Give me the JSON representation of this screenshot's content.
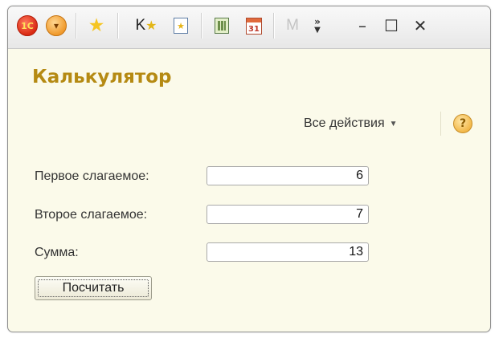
{
  "toolbar": {
    "logo_text": "1C",
    "k_label": "K",
    "calendar_day": "31",
    "m_label": "M",
    "more_label": "»"
  },
  "icons": {
    "logo": "1c-logo-icon",
    "menu": "main-menu-icon",
    "favorite": "favorite-star-icon",
    "bookmarks": "bookmarks-icon",
    "history": "history-icon",
    "calculator": "calculator-icon",
    "calendar": "calendar-icon",
    "more": "more-chevron-icon",
    "minimize": "minimize-icon",
    "maximize": "maximize-icon",
    "close": "close-icon",
    "help": "help-icon"
  },
  "form": {
    "title": "Калькулятор",
    "all_actions_label": "Все действия",
    "help_label": "?",
    "fields": [
      {
        "label": "Первое слагаемое:",
        "value": "6"
      },
      {
        "label": "Второе слагаемое:",
        "value": "7"
      },
      {
        "label": "Сумма:",
        "value": "13"
      }
    ],
    "calculate_button": "Посчитать"
  },
  "colors": {
    "title": "#b58a13",
    "form_background": "#fbfaea",
    "input_border": "#a9a9a9"
  }
}
